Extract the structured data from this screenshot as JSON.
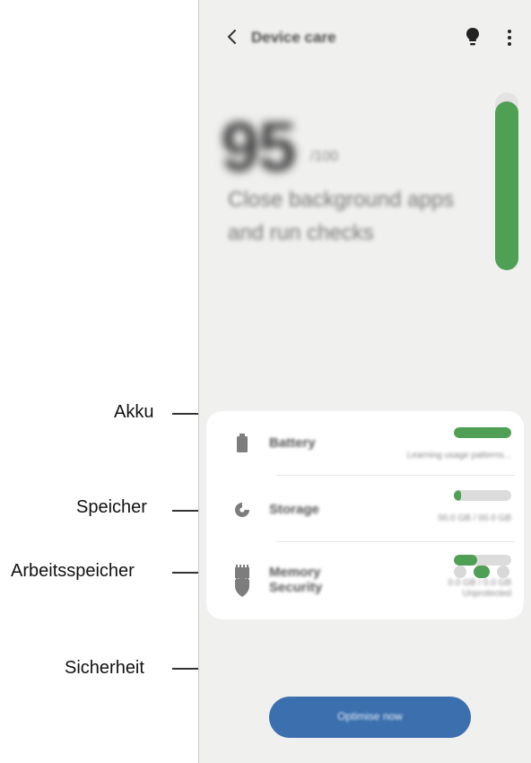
{
  "app": {
    "title": "Device care",
    "back_icon": "chevron-left-icon",
    "tips_icon": "lightbulb-icon",
    "more_icon": "more-vertical-icon"
  },
  "overview": {
    "score": "95",
    "score_unit": "/100",
    "subtitle": "Close background apps and run checks",
    "score_level": 0.95
  },
  "items": [
    {
      "label": "Battery",
      "status": "Learning usage patterns...",
      "icon": "battery-icon",
      "level": 1.0
    },
    {
      "label": "Storage",
      "status": "00.0 GB / 00.0 GB",
      "icon": "storage-pie-icon",
      "level": 0.12
    },
    {
      "label": "Memory",
      "status": "0.0 GB / 0.0 GB",
      "icon": "memory-chip-icon",
      "level": 0.4
    },
    {
      "label": "Security",
      "status": "Unprotected",
      "icon": "shield-icon"
    }
  ],
  "optimize_button": {
    "label": "Optimise now"
  },
  "callouts": {
    "battery": "Akku",
    "storage": "Speicher",
    "memory": "Arbeitsspeicher",
    "security": "Sicherheit"
  },
  "colors": {
    "accent_green": "#4f9f55",
    "button_blue": "#3b6fad",
    "background": "#f0f0ef"
  }
}
